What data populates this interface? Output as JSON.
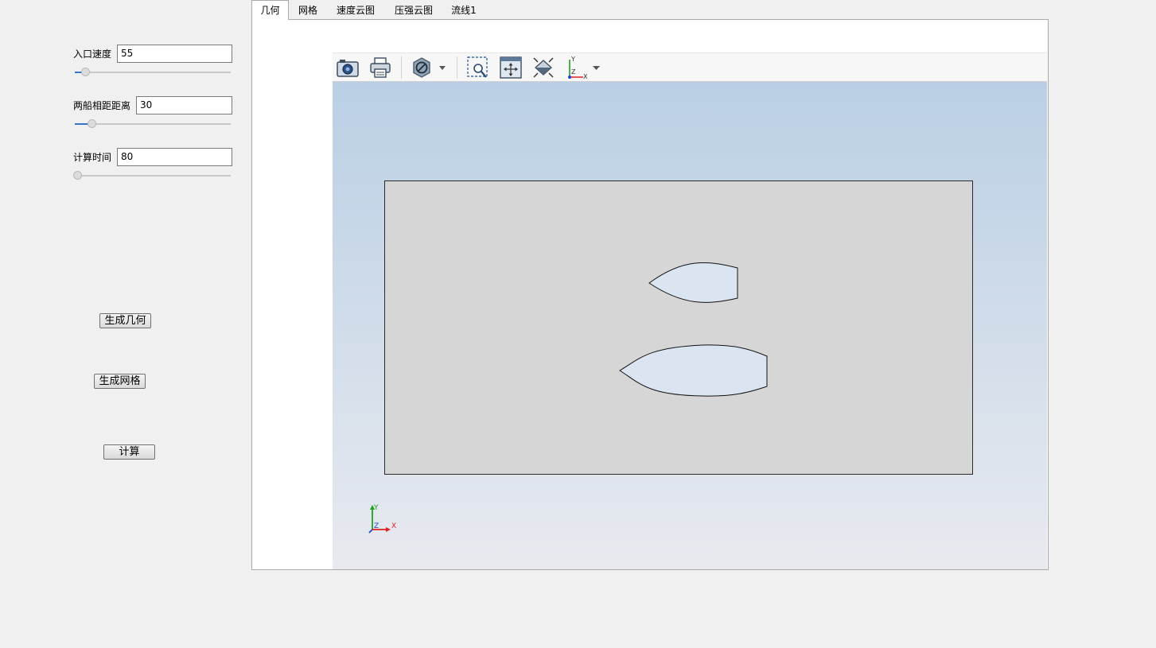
{
  "params": [
    {
      "label": "入口速度",
      "value": "55",
      "slider_fraction": 0.05
    },
    {
      "label": "两船相距距离",
      "value": "30",
      "slider_fraction": 0.09
    },
    {
      "label": "计算时间",
      "value": "80",
      "slider_fraction": 0.0
    }
  ],
  "buttons": {
    "generate_geometry": "生成几何",
    "generate_mesh": "生成网格",
    "compute": "计算"
  },
  "tabs": [
    "几何",
    "网格",
    "速度云图",
    "压强云图",
    "流线1"
  ],
  "active_tab": "几何",
  "toolbar": {
    "icons": [
      "camera-icon",
      "print-icon",
      "clip-plane-icon",
      "zoom-box-icon",
      "fit-view-icon",
      "reset-view-icon",
      "axis-orientation-icon"
    ]
  },
  "triad": {
    "y": "Y",
    "z": "Z",
    "x": "X"
  },
  "colors": {
    "domain_fill": "#d6d6d6",
    "hull_fill": "#dbe5f1",
    "axis_x": "#e02020",
    "axis_y": "#20a020",
    "axis_z": "#2040d0",
    "slider_fill": "#3874c8"
  }
}
